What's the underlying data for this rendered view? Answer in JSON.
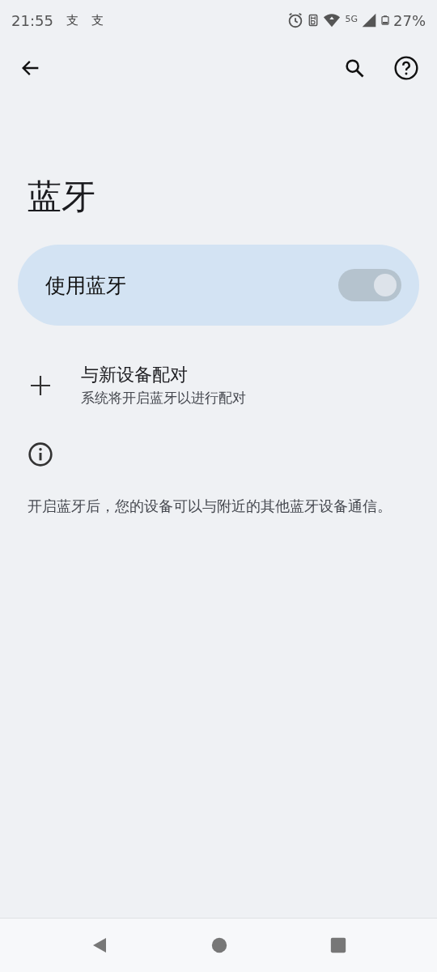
{
  "status_bar": {
    "time": "21:55",
    "notification_icons": [
      "支",
      "支"
    ],
    "network": "5G",
    "battery": "27%"
  },
  "title": "蓝牙",
  "main_switch": {
    "label": "使用蓝牙",
    "on": true,
    "disabled": true
  },
  "pair_item": {
    "title": "与新设备配对",
    "subtitle": "系统将开启蓝牙以进行配对"
  },
  "info_text": "开启蓝牙后，您的设备可以与附近的其他蓝牙设备通信。"
}
